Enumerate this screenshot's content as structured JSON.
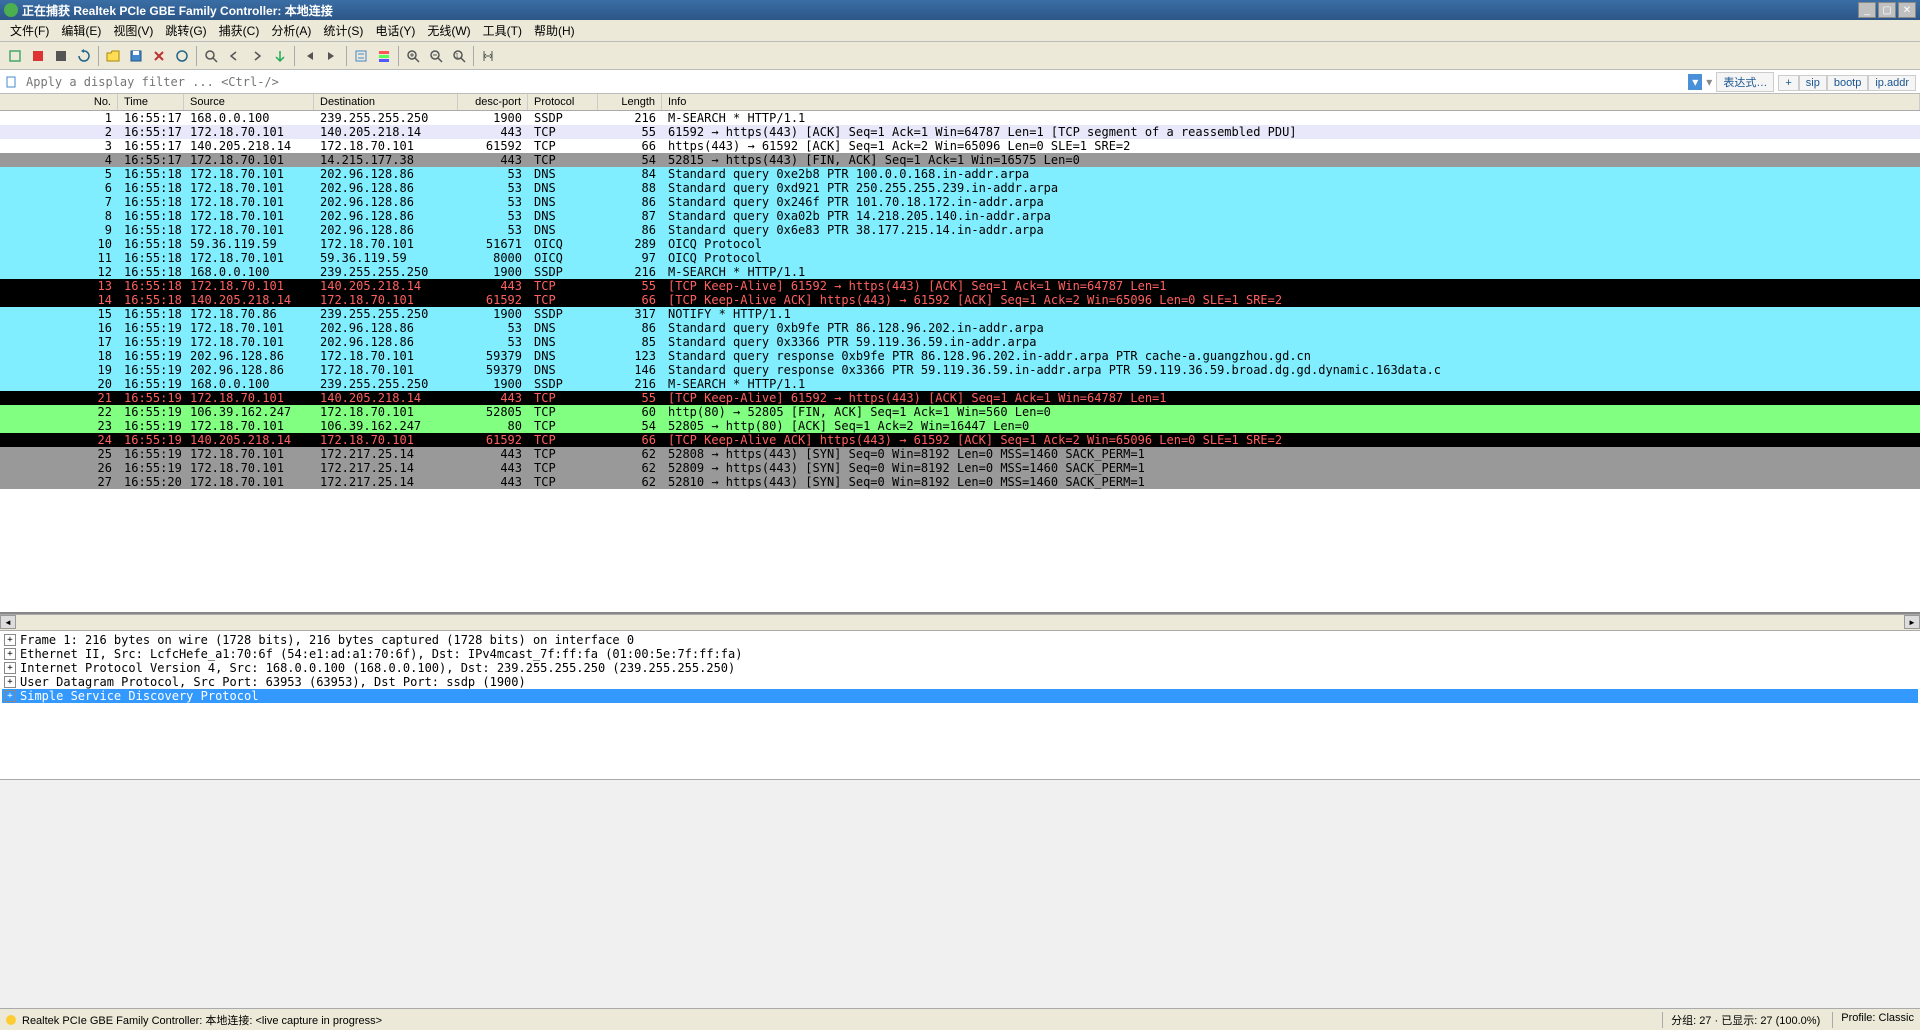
{
  "title": "正在捕获 Realtek PCIe GBE Family Controller: 本地连接",
  "menu": [
    "文件(F)",
    "编辑(E)",
    "视图(V)",
    "跳转(G)",
    "捕获(C)",
    "分析(A)",
    "统计(S)",
    "电话(Y)",
    "无线(W)",
    "工具(T)",
    "帮助(H)"
  ],
  "filter_placeholder": "Apply a display filter ... <Ctrl-/>",
  "expression_label": "表达式…",
  "filter_btns": [
    "+",
    "sip",
    "bootp",
    "ip.addr"
  ],
  "columns": [
    "No.",
    "Time",
    "Source",
    "Destination",
    "desc-port",
    "Protocol",
    "Length",
    "Info"
  ],
  "rows": [
    {
      "c": "default",
      "no": "1",
      "time": "16:55:17",
      "src": "168.0.0.100",
      "dst": "239.255.255.250",
      "dport": "1900",
      "proto": "SSDP",
      "len": "216",
      "info": "M-SEARCH * HTTP/1.1"
    },
    {
      "c": "lavender",
      "no": "2",
      "time": "16:55:17",
      "src": "172.18.70.101",
      "dst": "140.205.218.14",
      "dport": "443",
      "proto": "TCP",
      "len": "55",
      "info": "61592 → https(443) [ACK] Seq=1 Ack=1 Win=64787 Len=1 [TCP segment of a reassembled PDU]"
    },
    {
      "c": "default",
      "no": "3",
      "time": "16:55:17",
      "src": "140.205.218.14",
      "dst": "172.18.70.101",
      "dport": "61592",
      "proto": "TCP",
      "len": "66",
      "info": "https(443) → 61592 [ACK] Seq=1 Ack=2 Win=65096 Len=0 SLE=1 SRE=2"
    },
    {
      "c": "gray",
      "no": "4",
      "time": "16:55:17",
      "src": "172.18.70.101",
      "dst": "14.215.177.38",
      "dport": "443",
      "proto": "TCP",
      "len": "54",
      "info": "52815 → https(443) [FIN, ACK] Seq=1 Ack=1 Win=16575 Len=0"
    },
    {
      "c": "cyan",
      "no": "5",
      "time": "16:55:18",
      "src": "172.18.70.101",
      "dst": "202.96.128.86",
      "dport": "53",
      "proto": "DNS",
      "len": "84",
      "info": "Standard query 0xe2b8 PTR 100.0.0.168.in-addr.arpa"
    },
    {
      "c": "cyan",
      "no": "6",
      "time": "16:55:18",
      "src": "172.18.70.101",
      "dst": "202.96.128.86",
      "dport": "53",
      "proto": "DNS",
      "len": "88",
      "info": "Standard query 0xd921 PTR 250.255.255.239.in-addr.arpa"
    },
    {
      "c": "cyan",
      "no": "7",
      "time": "16:55:18",
      "src": "172.18.70.101",
      "dst": "202.96.128.86",
      "dport": "53",
      "proto": "DNS",
      "len": "86",
      "info": "Standard query 0x246f PTR 101.70.18.172.in-addr.arpa"
    },
    {
      "c": "cyan",
      "no": "8",
      "time": "16:55:18",
      "src": "172.18.70.101",
      "dst": "202.96.128.86",
      "dport": "53",
      "proto": "DNS",
      "len": "87",
      "info": "Standard query 0xa02b PTR 14.218.205.140.in-addr.arpa"
    },
    {
      "c": "cyan",
      "no": "9",
      "time": "16:55:18",
      "src": "172.18.70.101",
      "dst": "202.96.128.86",
      "dport": "53",
      "proto": "DNS",
      "len": "86",
      "info": "Standard query 0x6e83 PTR 38.177.215.14.in-addr.arpa"
    },
    {
      "c": "cyan",
      "no": "10",
      "time": "16:55:18",
      "src": "59.36.119.59",
      "dst": "172.18.70.101",
      "dport": "51671",
      "proto": "OICQ",
      "len": "289",
      "info": "OICQ Protocol"
    },
    {
      "c": "cyan",
      "no": "11",
      "time": "16:55:18",
      "src": "172.18.70.101",
      "dst": "59.36.119.59",
      "dport": "8000",
      "proto": "OICQ",
      "len": "97",
      "info": "OICQ Protocol"
    },
    {
      "c": "cyan",
      "no": "12",
      "time": "16:55:18",
      "src": "168.0.0.100",
      "dst": "239.255.255.250",
      "dport": "1900",
      "proto": "SSDP",
      "len": "216",
      "info": "M-SEARCH * HTTP/1.1"
    },
    {
      "c": "black",
      "no": "13",
      "time": "16:55:18",
      "src": "172.18.70.101",
      "dst": "140.205.218.14",
      "dport": "443",
      "proto": "TCP",
      "len": "55",
      "info": "[TCP Keep-Alive] 61592 → https(443) [ACK] Seq=1 Ack=1 Win=64787 Len=1"
    },
    {
      "c": "black",
      "no": "14",
      "time": "16:55:18",
      "src": "140.205.218.14",
      "dst": "172.18.70.101",
      "dport": "61592",
      "proto": "TCP",
      "len": "66",
      "info": "[TCP Keep-Alive ACK] https(443) → 61592 [ACK] Seq=1 Ack=2 Win=65096 Len=0 SLE=1 SRE=2"
    },
    {
      "c": "cyan",
      "no": "15",
      "time": "16:55:18",
      "src": "172.18.70.86",
      "dst": "239.255.255.250",
      "dport": "1900",
      "proto": "SSDP",
      "len": "317",
      "info": "NOTIFY * HTTP/1.1"
    },
    {
      "c": "cyan",
      "no": "16",
      "time": "16:55:19",
      "src": "172.18.70.101",
      "dst": "202.96.128.86",
      "dport": "53",
      "proto": "DNS",
      "len": "86",
      "info": "Standard query 0xb9fe PTR 86.128.96.202.in-addr.arpa"
    },
    {
      "c": "cyan",
      "no": "17",
      "time": "16:55:19",
      "src": "172.18.70.101",
      "dst": "202.96.128.86",
      "dport": "53",
      "proto": "DNS",
      "len": "85",
      "info": "Standard query 0x3366 PTR 59.119.36.59.in-addr.arpa"
    },
    {
      "c": "cyan",
      "no": "18",
      "time": "16:55:19",
      "src": "202.96.128.86",
      "dst": "172.18.70.101",
      "dport": "59379",
      "proto": "DNS",
      "len": "123",
      "info": "Standard query response 0xb9fe PTR 86.128.96.202.in-addr.arpa PTR cache-a.guangzhou.gd.cn"
    },
    {
      "c": "cyan",
      "no": "19",
      "time": "16:55:19",
      "src": "202.96.128.86",
      "dst": "172.18.70.101",
      "dport": "59379",
      "proto": "DNS",
      "len": "146",
      "info": "Standard query response 0x3366 PTR 59.119.36.59.in-addr.arpa PTR 59.119.36.59.broad.dg.gd.dynamic.163data.c"
    },
    {
      "c": "cyan",
      "no": "20",
      "time": "16:55:19",
      "src": "168.0.0.100",
      "dst": "239.255.255.250",
      "dport": "1900",
      "proto": "SSDP",
      "len": "216",
      "info": "M-SEARCH * HTTP/1.1"
    },
    {
      "c": "black",
      "no": "21",
      "time": "16:55:19",
      "src": "172.18.70.101",
      "dst": "140.205.218.14",
      "dport": "443",
      "proto": "TCP",
      "len": "55",
      "info": "[TCP Keep-Alive] 61592 → https(443) [ACK] Seq=1 Ack=1 Win=64787 Len=1"
    },
    {
      "c": "green",
      "no": "22",
      "time": "16:55:19",
      "src": "106.39.162.247",
      "dst": "172.18.70.101",
      "dport": "52805",
      "proto": "TCP",
      "len": "60",
      "info": "http(80) → 52805 [FIN, ACK] Seq=1 Ack=1 Win=560 Len=0"
    },
    {
      "c": "green",
      "no": "23",
      "time": "16:55:19",
      "src": "172.18.70.101",
      "dst": "106.39.162.247",
      "dport": "80",
      "proto": "TCP",
      "len": "54",
      "info": "52805 → http(80) [ACK] Seq=1 Ack=2 Win=16447 Len=0"
    },
    {
      "c": "black",
      "no": "24",
      "time": "16:55:19",
      "src": "140.205.218.14",
      "dst": "172.18.70.101",
      "dport": "61592",
      "proto": "TCP",
      "len": "66",
      "info": "[TCP Keep-Alive ACK] https(443) → 61592 [ACK] Seq=1 Ack=2 Win=65096 Len=0 SLE=1 SRE=2"
    },
    {
      "c": "gray",
      "no": "25",
      "time": "16:55:19",
      "src": "172.18.70.101",
      "dst": "172.217.25.14",
      "dport": "443",
      "proto": "TCP",
      "len": "62",
      "info": "52808 → https(443) [SYN] Seq=0 Win=8192 Len=0 MSS=1460 SACK_PERM=1"
    },
    {
      "c": "gray",
      "no": "26",
      "time": "16:55:19",
      "src": "172.18.70.101",
      "dst": "172.217.25.14",
      "dport": "443",
      "proto": "TCP",
      "len": "62",
      "info": "52809 → https(443) [SYN] Seq=0 Win=8192 Len=0 MSS=1460 SACK_PERM=1"
    },
    {
      "c": "gray",
      "no": "27",
      "time": "16:55:20",
      "src": "172.18.70.101",
      "dst": "172.217.25.14",
      "dport": "443",
      "proto": "TCP",
      "len": "62",
      "info": "52810 → https(443) [SYN] Seq=0 Win=8192 Len=0 MSS=1460 SACK_PERM=1"
    }
  ],
  "details": [
    "Frame 1: 216 bytes on wire (1728 bits), 216 bytes captured (1728 bits) on interface 0",
    "Ethernet II, Src: LcfcHefe_a1:70:6f (54:e1:ad:a1:70:6f), Dst: IPv4mcast_7f:ff:fa (01:00:5e:7f:ff:fa)",
    "Internet Protocol Version 4, Src: 168.0.0.100 (168.0.0.100), Dst: 239.255.255.250 (239.255.255.250)",
    "User Datagram Protocol, Src Port: 63953 (63953), Dst Port: ssdp (1900)",
    "Simple Service Discovery Protocol"
  ],
  "status": {
    "left": "Realtek PCIe GBE Family Controller: 本地连接: <live capture in progress>",
    "center": "分组: 27 · 已显示: 27 (100.0%)",
    "right": "Profile: Classic"
  }
}
